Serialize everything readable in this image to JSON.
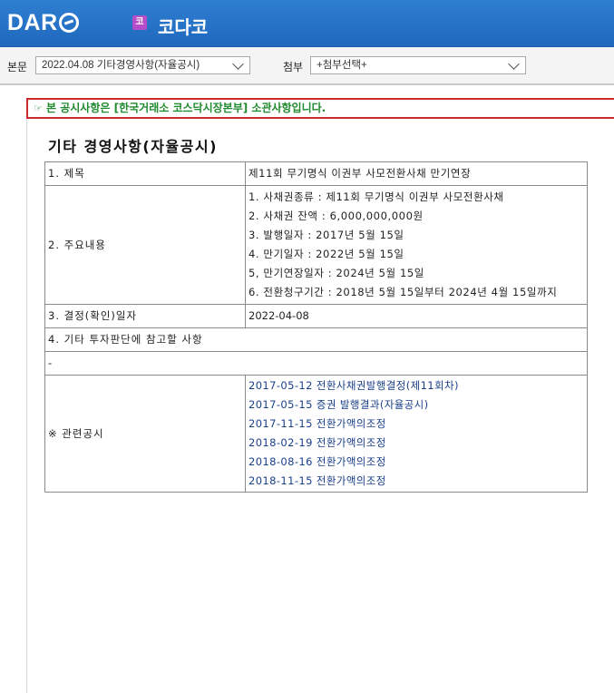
{
  "header": {
    "logo": "DART",
    "company_icon": "코",
    "company_name": "코다코"
  },
  "toolbar": {
    "main_label": "본문",
    "main_select_value": "2022.04.08  기타경영사항(자율공시)",
    "attach_label": "첨부",
    "attach_select_value": "+첨부선택+"
  },
  "notice": "본 공시사항은 [한국거래소 코스닥시장본부] 소관사항입니다.",
  "document": {
    "title": "기타 경영사항(자율공시)",
    "rows": {
      "subject_label": "1. 제목",
      "subject_value": "제11회 무기명식 이권부 사모전환사채 만기연장",
      "details_label": "2. 주요내용",
      "details_lines": [
        "1. 사채권종류 : 제11회 무기명식 이권부 사모전환사채",
        "2. 사채권 잔액 : 6,000,000,000원",
        "3. 발행일자 : 2017년 5월 15일",
        "4. 만기일자 : 2022년 5월 15일",
        "5, 만기연장일자 : 2024년 5월 15일",
        "6. 전환청구기간 : 2018년 5월 15일부터 2024년 4월 15일까지"
      ],
      "decision_label": "3. 결정(확인)일자",
      "decision_value": "2022-04-08",
      "other_label": "4. 기타 투자판단에 참고할 사항",
      "other_value": "-",
      "related_label": "※ 관련공시",
      "related_links": [
        "2017-05-12 전환사채권발행결정(제11회차)",
        "2017-05-15 증권 발행결과(자율공시)",
        "2017-11-15 전환가액의조정",
        "2018-02-19 전환가액의조정",
        "2018-08-16 전환가액의조정",
        "2018-11-15 전환가액의조정"
      ]
    }
  },
  "colors": {
    "header_blue": "#1f68be",
    "notice_border": "#cf2a2a",
    "notice_text": "#1f8a2e",
    "link": "#1a3f8a"
  }
}
